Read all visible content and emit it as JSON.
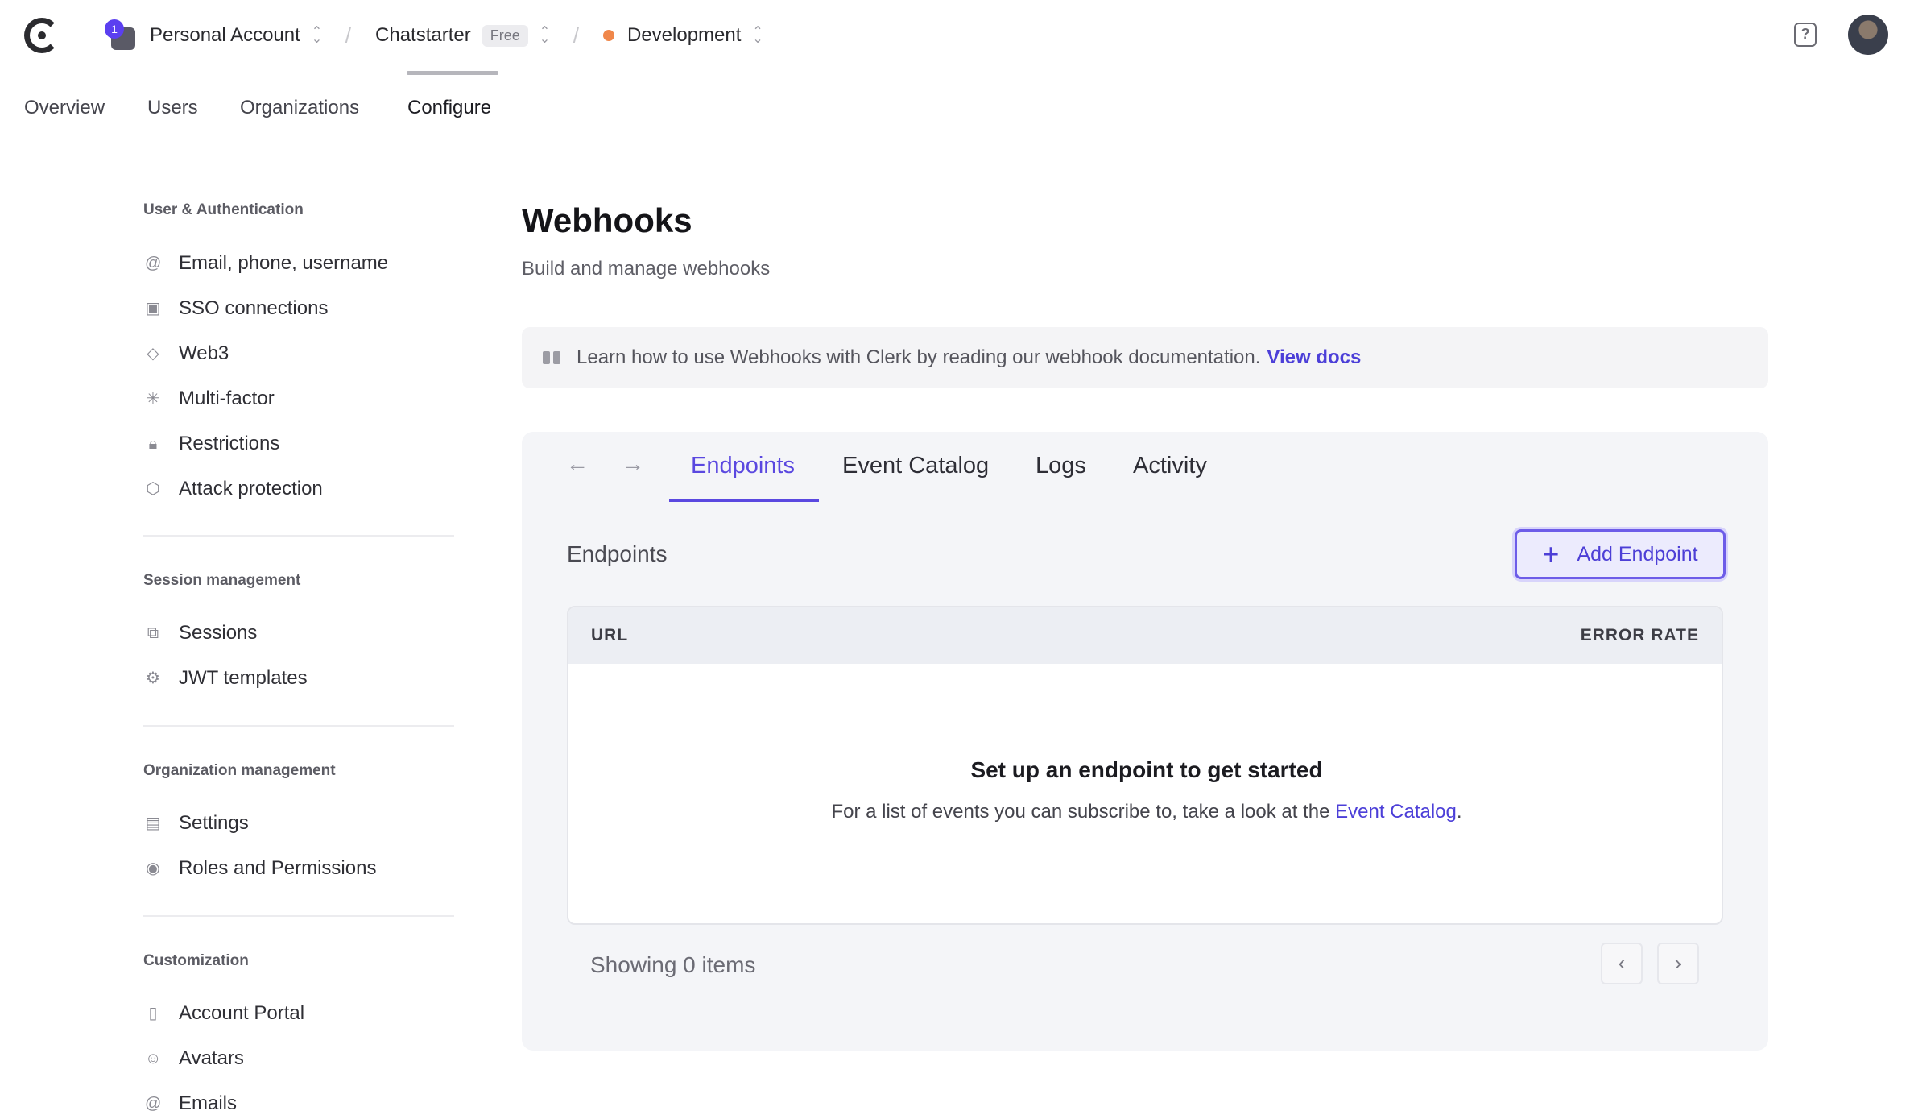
{
  "topbar": {
    "account_badge": "1",
    "account_name": "Personal Account",
    "app_name": "Chatstarter",
    "plan_badge": "Free",
    "environment": "Development",
    "help_icon": "?"
  },
  "nav": {
    "items": [
      "Overview",
      "Users",
      "Organizations",
      "Configure"
    ],
    "active": "Configure"
  },
  "sidebar": {
    "sections": [
      {
        "title": "User & Authentication",
        "items": [
          {
            "label": "Email, phone, username",
            "icon": "at-icon"
          },
          {
            "label": "SSO connections",
            "icon": "sso-icon"
          },
          {
            "label": "Web3",
            "icon": "web3-icon"
          },
          {
            "label": "Multi-factor",
            "icon": "asterisk-icon"
          },
          {
            "label": "Restrictions",
            "icon": "lock-icon"
          },
          {
            "label": "Attack protection",
            "icon": "shield-icon"
          }
        ]
      },
      {
        "title": "Session management",
        "items": [
          {
            "label": "Sessions",
            "icon": "sessions-icon"
          },
          {
            "label": "JWT templates",
            "icon": "gear-icon"
          }
        ]
      },
      {
        "title": "Organization management",
        "items": [
          {
            "label": "Settings",
            "icon": "building-icon"
          },
          {
            "label": "Roles and Permissions",
            "icon": "user-circle-icon"
          }
        ]
      },
      {
        "title": "Customization",
        "items": [
          {
            "label": "Account Portal",
            "icon": "portal-icon"
          },
          {
            "label": "Avatars",
            "icon": "avatar-icon"
          },
          {
            "label": "Emails",
            "icon": "at-icon"
          }
        ]
      }
    ]
  },
  "main": {
    "title": "Webhooks",
    "subtitle": "Build and manage webhooks",
    "banner": {
      "text": "Learn how to use Webhooks with Clerk by reading our webhook documentation.",
      "link": "View docs"
    },
    "tabs": [
      "Endpoints",
      "Event Catalog",
      "Logs",
      "Activity"
    ],
    "active_tab": "Endpoints",
    "section_label": "Endpoints",
    "add_button": "Add Endpoint",
    "table": {
      "columns": [
        "URL",
        "ERROR RATE"
      ],
      "empty_title": "Set up an endpoint to get started",
      "empty_text": "For a list of events you can subscribe to, take a look at the",
      "empty_link": "Event Catalog",
      "empty_suffix": "."
    },
    "showing": "Showing 0 items"
  },
  "colors": {
    "accent": "#5a48e0",
    "env_dot": "#f0874a"
  }
}
